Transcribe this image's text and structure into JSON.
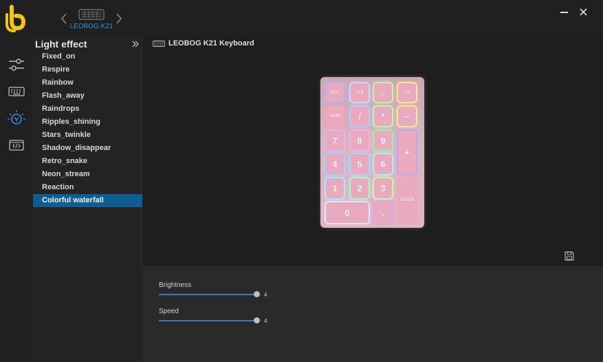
{
  "device": {
    "name": "LEOBOG K21",
    "title": "LEOBOG K21 Keyboard"
  },
  "panel": {
    "title": "Light effect",
    "effects": [
      "Fixed_on",
      "Respire",
      "Rainbow",
      "Flash_away",
      "Raindrops",
      "Ripples_shining",
      "Stars_twinkle",
      "Shadow_disappear",
      "Retro_snake",
      "Neon_stream",
      "Reaction",
      "Colorful waterfall"
    ],
    "selected": "Colorful waterfall"
  },
  "sliders": {
    "brightness": {
      "label": "Brightness",
      "value": "4",
      "fraction": 1.0
    },
    "speed": {
      "label": "Speed",
      "value": "4",
      "fraction": 1.0
    }
  },
  "keys": [
    {
      "label": "ESC",
      "glow": "#b7b0f0",
      "big": false
    },
    {
      "label": "TAB",
      "glow": "#c8d8ff",
      "big": false
    },
    {
      "label": "←",
      "glow": "#c8f0b0",
      "big": true
    },
    {
      "label": "FN",
      "glow": "#f6e890",
      "big": false
    },
    {
      "label": "NUM",
      "glow": "#f4a0b8",
      "big": false
    },
    {
      "label": "/",
      "glow": "#b8c8ff",
      "big": true
    },
    {
      "label": "*",
      "glow": "#b8f7a8",
      "big": true
    },
    {
      "label": "−",
      "glow": "#f4e890",
      "big": true
    },
    {
      "label": "7",
      "glow": "#e6b0e8",
      "big": true
    },
    {
      "label": "8",
      "glow": "#f0b4d8",
      "big": true
    },
    {
      "label": "9",
      "glow": "#9ef39a",
      "big": true
    },
    {
      "label": "+",
      "glow": "#c0a8e8",
      "big": true
    },
    {
      "label": "4",
      "glow": "#9ad8f8",
      "big": true
    },
    {
      "label": "5",
      "glow": "#a8d8ff",
      "big": true
    },
    {
      "label": "6",
      "glow": "#a8f0e8",
      "big": true
    },
    {
      "label": "1",
      "glow": "#a8e8ff",
      "big": true
    },
    {
      "label": "2",
      "glow": "#a8f8d0",
      "big": true
    },
    {
      "label": "3",
      "glow": "#c8f8a8",
      "big": true
    },
    {
      "label": "ENTER",
      "glow": "#f0a8b8",
      "big": false
    },
    {
      "label": "0",
      "glow": "#d8e8ff",
      "big": true
    },
    {
      "label": ".",
      "glow": "#d8a8e8",
      "big": true
    }
  ],
  "colors": {
    "accent": "#2e8fe0",
    "logo": "#f2c318",
    "selected": "#0f5d93"
  }
}
